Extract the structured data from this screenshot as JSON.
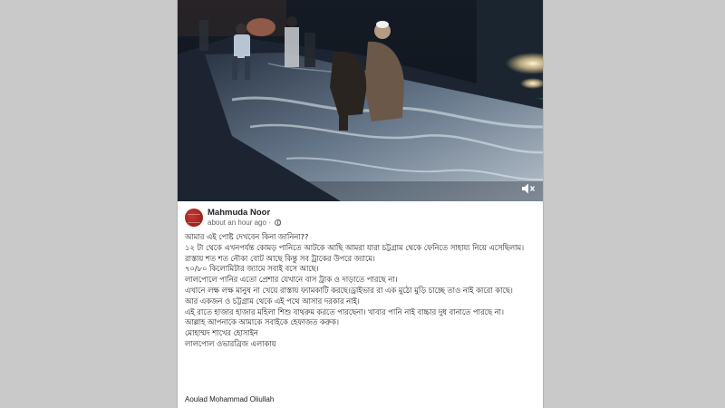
{
  "post": {
    "author": "Mahmuda Noor",
    "timestamp": "about an hour ago",
    "visibility_icon": "globe-icon",
    "lines": [
      "আমার এই পোষ্ট দেখবেন কিনা জানিনা??",
      "১২ টা থেকে এখনপর্যন্ত কোমড় পানিতে আটকে আছি আমরা যারা চট্টগ্রাম থেকে ফেনিতে সাহায্য নিয়ে এসেছিলাম।",
      "রাস্তায় শত শত নৌকা বোট আছে কিন্তু সব ট্রাকের উপরে জ্যামে।",
      "৭০/৮০ কিলোমিটার জ্যামে সবাই বসে আছে।",
      "লালপোলে পানির এতো প্রেশার যেখানে বাস ট্রাক ও দাড়াতে পারছে না।",
      "এখানে লক্ষ লক্ষ মানুষ না খেয়ে রাস্তায় ফ্যামকাটি করছে।ড্রাইভার রা এক মুঠো মুড়ি চাচ্ছে তাও নাই কারো কাছে।",
      "আর একজন ও চট্টগ্রাম থেকে এই পথে আসার দরকার নাই।",
      "এই রাতে হাজার হাজার মহিলা শিশু বাথরুম করতে পারছেনা। খাবার পানি নাই বাচ্চার দুধ বানাতে পারছে না।",
      "আল্লাহ আপনাকে আমাকে সবাইকে হেফাজত করুক।",
      "মোহাম্মদ শাখের হোসাইন",
      "লালপোল ওভারব্রিজ এলাকায়"
    ],
    "signature": "Aoulad Mohammad Oliullah"
  },
  "video": {
    "mute_icon": "speaker-muted-icon",
    "water_color": "#9fb1c0",
    "road_color": "#1c2432"
  }
}
